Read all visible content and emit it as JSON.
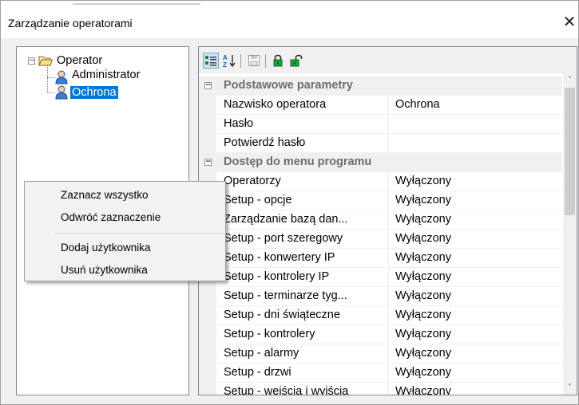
{
  "window": {
    "title": "Zarządzanie operatorami",
    "close_glyph": "✕"
  },
  "tree": {
    "root_label": "Operator",
    "children": [
      {
        "label": "Administrator",
        "selected": false
      },
      {
        "label": "Ochrona",
        "selected": true
      }
    ],
    "expander_glyph": "−"
  },
  "toolbar": {
    "buttons": [
      {
        "name": "categorized-view-icon",
        "active": true
      },
      {
        "name": "sort-alphabetical-icon",
        "active": false
      },
      {
        "name": "save-icon",
        "active": false
      },
      {
        "name": "lock-icon",
        "active": false
      },
      {
        "name": "unlock-icon",
        "active": false
      }
    ]
  },
  "grid": {
    "category_expander_glyph": "−",
    "categories": [
      {
        "title": "Podstawowe parametry",
        "rows": [
          {
            "name": "Nazwisko operatora",
            "value": "Ochrona"
          },
          {
            "name": "Hasło",
            "value": ""
          },
          {
            "name": "Potwierdź hasło",
            "value": ""
          }
        ]
      },
      {
        "title": "Dostęp do menu programu",
        "rows": [
          {
            "name": "Operatorzy",
            "value": "Wyłączony"
          },
          {
            "name": "Setup - opcje",
            "value": "Wyłączony"
          },
          {
            "name": "Zarządzanie bazą dan...",
            "value": "Wyłączony"
          },
          {
            "name": "Setup - port szeregowy",
            "value": "Wyłączony"
          },
          {
            "name": "Setup - konwertery IP",
            "value": "Wyłączony"
          },
          {
            "name": "Setup - kontrolery IP",
            "value": "Wyłączony"
          },
          {
            "name": "Setup - terminarze tyg...",
            "value": "Wyłączony"
          },
          {
            "name": "Setup - dni świąteczne",
            "value": "Wyłączony"
          },
          {
            "name": "Setup - kontrolery",
            "value": "Wyłączony"
          },
          {
            "name": "Setup - alarmy",
            "value": "Wyłączony"
          },
          {
            "name": "Setup - drzwi",
            "value": "Wyłączony"
          },
          {
            "name": "Setup - wejścia i wyjścia",
            "value": "Wyłączony"
          }
        ]
      }
    ]
  },
  "scrollbar": {
    "up_glyph": "˄",
    "down_glyph": "˅"
  },
  "context_menu": {
    "items": [
      {
        "label": "Zaznacz wszystko"
      },
      {
        "label": "Odwróć zaznaczenie"
      },
      {
        "label": "Dodaj użytkownika"
      },
      {
        "label": "Usuń użytkownika"
      }
    ]
  },
  "colors": {
    "selection": "#0078d7",
    "toolbar_active": "#cce4f7",
    "icon_gray": "#808080",
    "icon_green": "#1aa33a",
    "user_icon_blue": "#3a7bd5"
  }
}
